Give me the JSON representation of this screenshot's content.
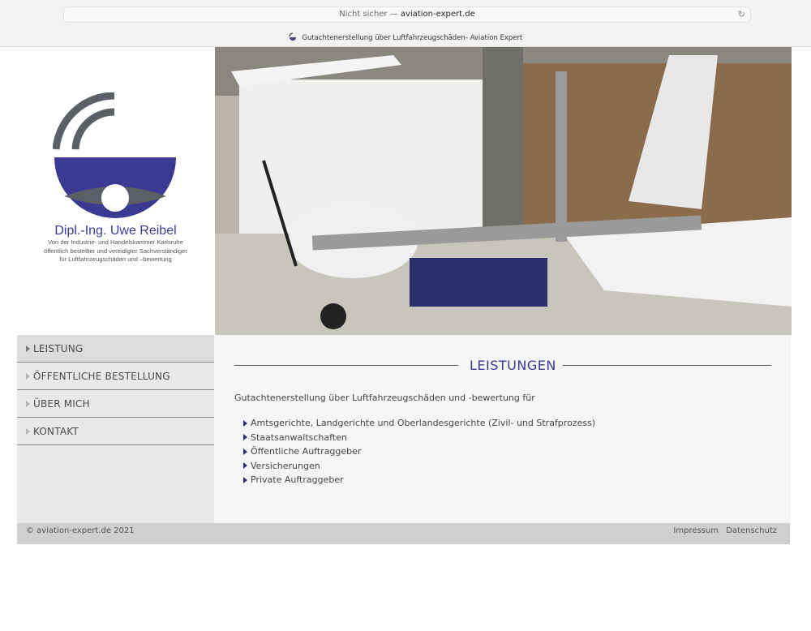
{
  "browser": {
    "security": "Nicht sicher —",
    "domain": "aviation-expert.de",
    "tab_title": "Gutachtenerstellung über Luftfahrzeugschäden- Aviation Expert"
  },
  "logo": {
    "name": "Dipl.-Ing. Uwe Reibel",
    "line1": "Von der Industrie- und Handelskammer Karlsruhe",
    "line2": "öffentlich bestellter und vereidigter Sachverständiger",
    "line3": "für Luftfahrzeugschäden und –bewertung"
  },
  "nav": {
    "items": [
      {
        "label": "LEISTUNG"
      },
      {
        "label": "ÖFFENTLICHE BESTELLUNG"
      },
      {
        "label": "ÜBER MICH"
      },
      {
        "label": "KONTAKT"
      }
    ]
  },
  "main": {
    "heading": "LEISTUNGEN",
    "intro": "Gutachtenerstellung über Luftfahrzeugschäden und -bewertung für",
    "list": [
      "Amtsgerichte, Landgerichte und Oberlandesgerichte (Zivil- und Strafprozess)",
      "Staatsanwaltschaften",
      "Öffentliche Auftraggeber",
      "Versicherungen",
      "Private Auftraggeber"
    ]
  },
  "footer": {
    "copyright": "© aviation-expert.de 2021",
    "impressum": "Impressum",
    "datenschutz": "Datenschutz"
  },
  "colors": {
    "brand_blue": "#3a3a92",
    "logo_gray": "#5b5f66",
    "footer_bg": "#cfcfcf"
  }
}
